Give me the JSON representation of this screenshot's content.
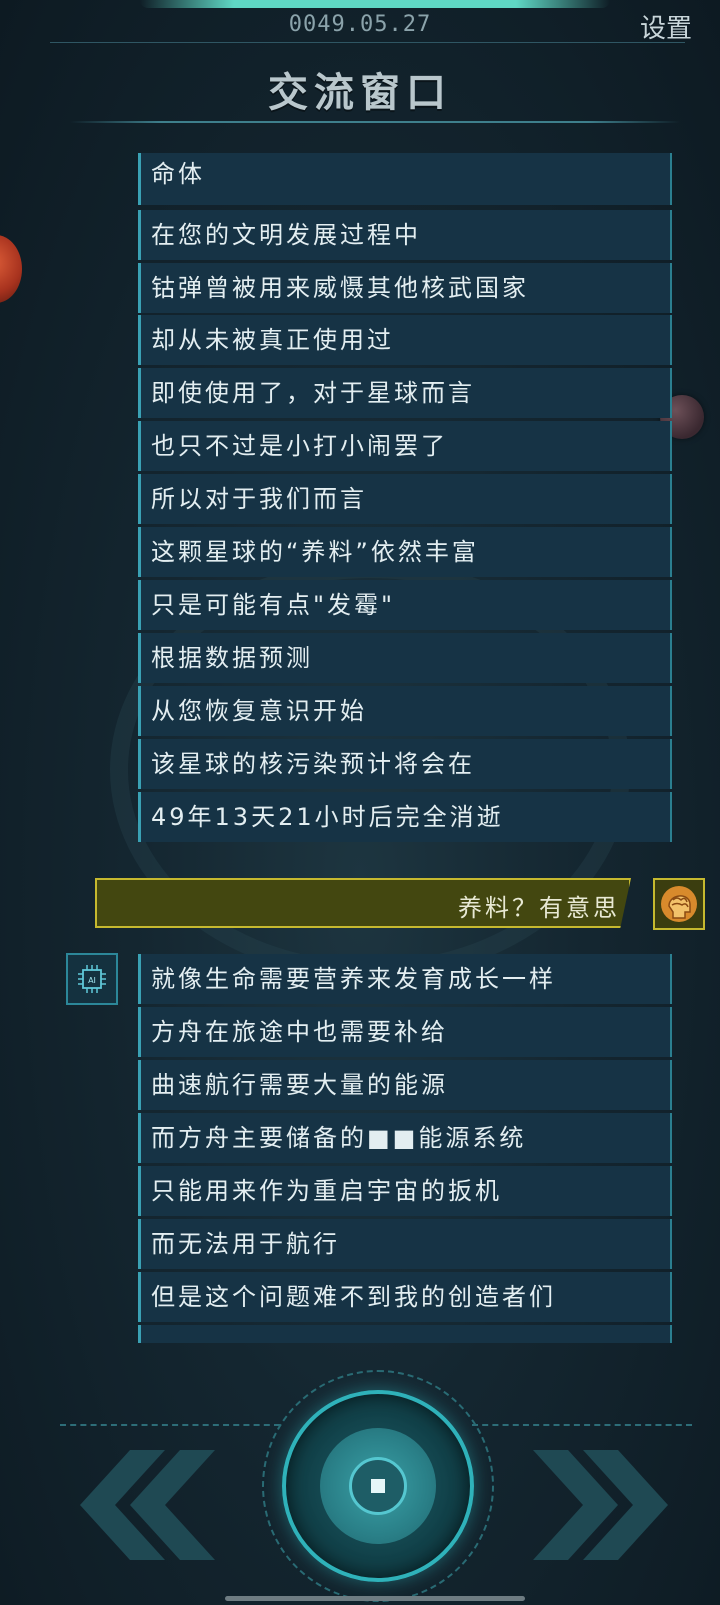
{
  "header": {
    "date": "0049.05.27",
    "settings_label": "设置",
    "title": "交流窗口"
  },
  "conversation_top": [
    "命体",
    "在您的文明发展过程中",
    "钴弹曾被用来威慑其他核武国家",
    "却从未被真正使用过",
    "即使使用了，对于星球而言",
    "也只不过是小打小闹罢了",
    "所以对于我们而言",
    "这颗星球的“养料”依然丰富",
    "只是可能有点\"发霉\"",
    "根据数据预测",
    "从您恢复意识开始",
    "该星球的核污染预计将会在",
    "49年13天21小时后完全消逝"
  ],
  "user_reply": "养料？有意思",
  "ai_avatar_label": "AI",
  "conversation_bottom": [
    "就像生命需要营养来发育成长一样",
    "方舟在旅途中也需要补给",
    "曲速航行需要大量的能源",
    "而方舟主要储备的■■能源系统",
    "只能用来作为重启宇宙的扳机",
    "而无法用于航行",
    "但是这个问题难不到我的创造者们"
  ],
  "colors": {
    "accent_cyan": "#3aa1b4",
    "user_yellow": "#c6b92f",
    "bubble_bg": "#163345"
  }
}
